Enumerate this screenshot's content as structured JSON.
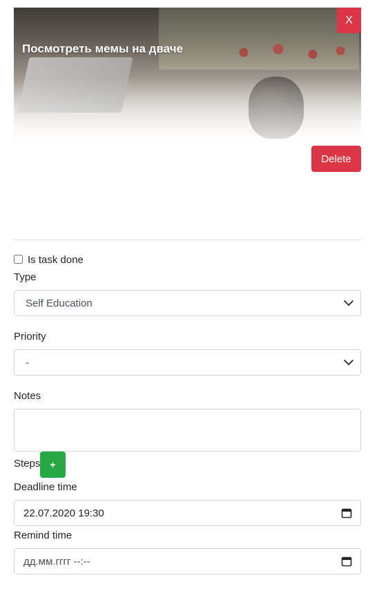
{
  "card": {
    "title": "Посмотреть мемы на дваче",
    "close_label": "X",
    "delete_label": "Delete"
  },
  "form": {
    "done_label": "Is task done",
    "done_checked": false,
    "type_label": "Type",
    "type_value": "Self Education",
    "priority_label": "Priority",
    "priority_value": "-",
    "notes_label": "Notes",
    "notes_value": "",
    "steps_label": "Steps",
    "add_step_label": "+",
    "deadline_label": "Deadline time",
    "deadline_value": "22.07.2020 19:30",
    "remind_label": "Remind time",
    "remind_value": "дд.мм.гггг --:--"
  },
  "colors": {
    "danger": "#dc3545",
    "success": "#28a745",
    "border": "#ced4da"
  }
}
